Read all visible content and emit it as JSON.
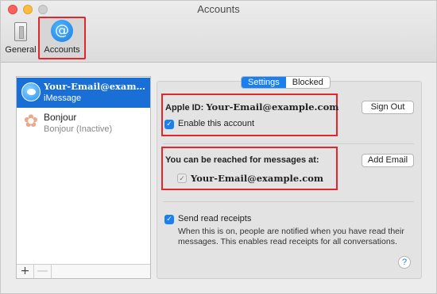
{
  "window": {
    "title": "Accounts"
  },
  "toolbar": {
    "general_label": "General",
    "accounts_label": "Accounts",
    "accounts_icon_glyph": "@"
  },
  "sidebar": {
    "accounts": [
      {
        "name": "Your-Email@exam…",
        "subtitle": "iMessage",
        "icon": "imessage-icon",
        "selected": true
      },
      {
        "name": "Bonjour",
        "subtitle": "Bonjour (Inactive)",
        "icon": "bonjour-icon",
        "selected": false
      }
    ],
    "add_label": "+",
    "remove_label": "—"
  },
  "tabs": {
    "settings": "Settings",
    "blocked": "Blocked",
    "active": "Settings"
  },
  "settings": {
    "apple_id_label": "Apple ID:",
    "apple_id_value": "Your-Email@example.com",
    "sign_out_label": "Sign Out",
    "enable_label": "Enable this account",
    "enable_checked": true,
    "reach_label": "You can be reached for messages at:",
    "add_email_label": "Add Email",
    "reach_email": "Your-Email@example.com",
    "reach_email_checked": true,
    "read_receipts_label": "Send read receipts",
    "read_receipts_checked": true,
    "read_receipts_desc": "When this is on, people are notified when you have read their messages. This enables read receipts for all conversations.",
    "help_label": "?"
  },
  "colors": {
    "accent": "#1a7ff0",
    "highlight_box": "#e2262b",
    "selection": "#1a6fd6"
  }
}
